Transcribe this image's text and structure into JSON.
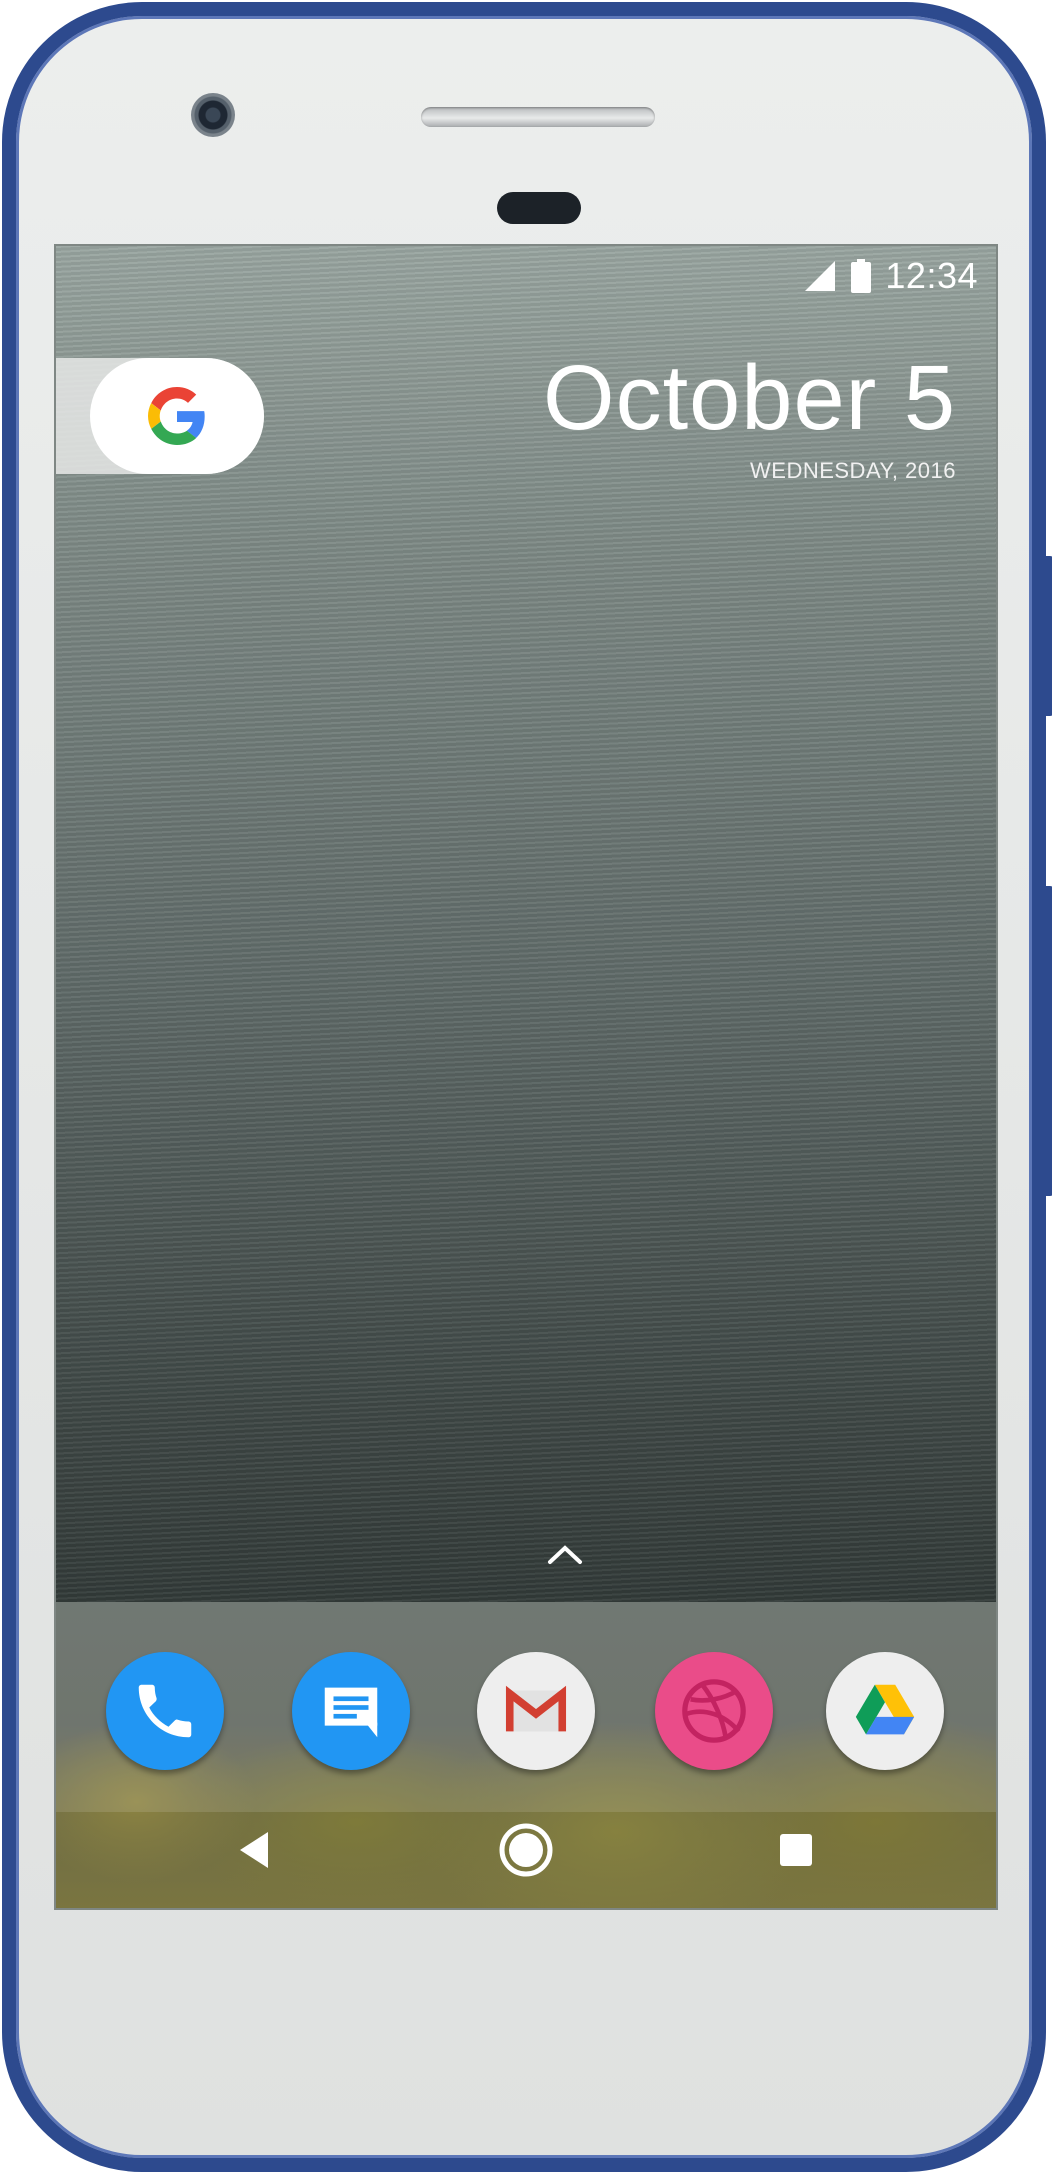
{
  "status_bar": {
    "time": "12:34",
    "icons": [
      "signal-icon",
      "battery-icon"
    ]
  },
  "search_widget": {
    "icon": "google-g-icon",
    "colors": {
      "blue": "#4285F4",
      "red": "#EA4335",
      "yellow": "#FBBC05",
      "green": "#34A853"
    }
  },
  "date_widget": {
    "date": "October 5",
    "weekday_year": "WEDNESDAY, 2016"
  },
  "app_drawer_hint": {
    "icon": "chevron-up-icon"
  },
  "dock": {
    "apps": [
      {
        "name": "phone",
        "icon": "phone-icon",
        "color": "#2196F3"
      },
      {
        "name": "messages",
        "icon": "message-icon",
        "color": "#2196F3"
      },
      {
        "name": "gmail",
        "icon": "gmail-icon",
        "color": "#EEEEEE"
      },
      {
        "name": "dribbble",
        "icon": "dribbble-icon",
        "color": "#EA4C89"
      },
      {
        "name": "drive",
        "icon": "drive-icon",
        "color": "#EEEEEE"
      }
    ]
  },
  "navigation": {
    "buttons": [
      "back-icon",
      "home-icon",
      "recents-icon"
    ]
  },
  "device": {
    "frame_color": "#2D4A8E"
  }
}
